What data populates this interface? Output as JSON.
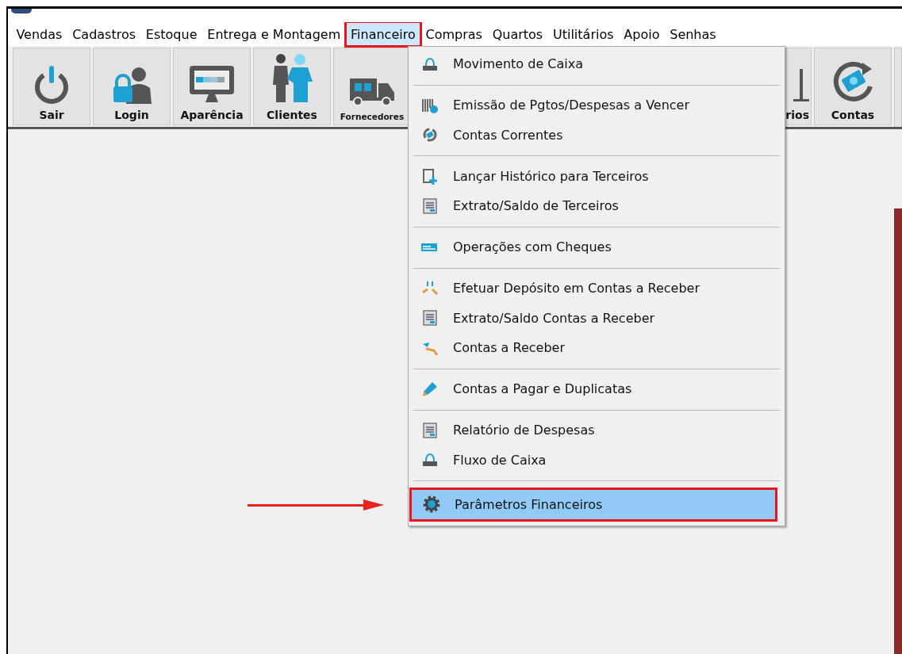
{
  "menu_bar": [
    {
      "label": "Vendas",
      "selected": false
    },
    {
      "label": "Cadastros",
      "selected": false
    },
    {
      "label": "Estoque",
      "selected": false
    },
    {
      "label": "Entrega e Montagem",
      "selected": false
    },
    {
      "label": "Financeiro",
      "selected": true
    },
    {
      "label": "Compras",
      "selected": false
    },
    {
      "label": "Quartos",
      "selected": false
    },
    {
      "label": "Utilitários",
      "selected": false
    },
    {
      "label": "Apoio",
      "selected": false
    },
    {
      "label": "Senhas",
      "selected": false
    }
  ],
  "toolbar": {
    "buttons": [
      {
        "label": "Sair"
      },
      {
        "label": "Login"
      },
      {
        "label": "Aparência"
      },
      {
        "label": "Clientes"
      },
      {
        "label": "Fornecedores"
      }
    ],
    "right_buttons": [
      {
        "label": "rios"
      },
      {
        "label": "Contas"
      }
    ]
  },
  "dropdown": {
    "groups": [
      {
        "items": [
          {
            "label": "Movimento de Caixa",
            "selected": false
          }
        ]
      },
      {
        "items": [
          {
            "label": "Emissão de Pgtos/Despesas a Vencer",
            "selected": false
          },
          {
            "label": "Contas Correntes",
            "selected": false
          }
        ]
      },
      {
        "items": [
          {
            "label": "Lançar Histórico para Terceiros",
            "selected": false
          },
          {
            "label": "Extrato/Saldo de Terceiros",
            "selected": false
          }
        ]
      },
      {
        "items": [
          {
            "label": "Operações com Cheques",
            "selected": false
          }
        ]
      },
      {
        "items": [
          {
            "label": "Efetuar Depósito em Contas a Receber",
            "selected": false
          },
          {
            "label": "Extrato/Saldo Contas a Receber",
            "selected": false
          },
          {
            "label": "Contas a Receber",
            "selected": false
          }
        ]
      },
      {
        "items": [
          {
            "label": "Contas a Pagar e Duplicatas",
            "selected": false
          }
        ]
      },
      {
        "items": [
          {
            "label": "Relatório de Despesas",
            "selected": false
          },
          {
            "label": "Fluxo de Caixa",
            "selected": false
          }
        ]
      },
      {
        "items": [
          {
            "label": "Parâmetros Financeiros",
            "selected": true
          }
        ]
      }
    ]
  }
}
